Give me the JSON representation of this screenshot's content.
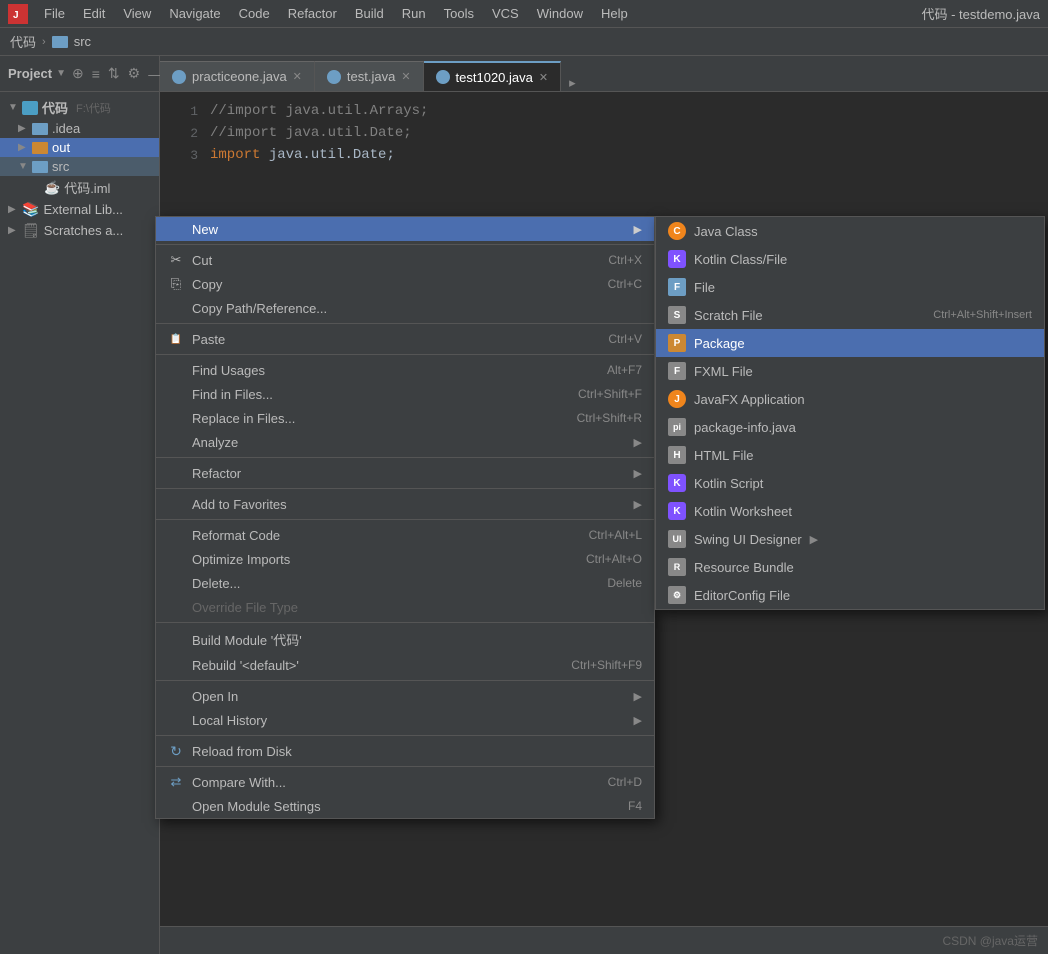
{
  "menubar": {
    "items": [
      "File",
      "Edit",
      "View",
      "Navigate",
      "Code",
      "Refactor",
      "Build",
      "Run",
      "Tools",
      "VCS",
      "Window",
      "Help"
    ],
    "title": "代码 - testdemo.java"
  },
  "breadcrumb": {
    "items": [
      "代码",
      "src"
    ]
  },
  "sidebar": {
    "title": "Project",
    "tree": [
      {
        "label": "代码",
        "sub": "F:\\代码",
        "type": "root",
        "indent": 0,
        "expanded": true
      },
      {
        "label": ".idea",
        "type": "folder",
        "indent": 1
      },
      {
        "label": "out",
        "type": "folder-orange",
        "indent": 1,
        "selected": true
      },
      {
        "label": "src",
        "type": "folder",
        "indent": 1,
        "highlighted": true
      },
      {
        "label": "代码.iml",
        "type": "file",
        "indent": 2
      },
      {
        "label": "External Lib...",
        "type": "lib",
        "indent": 0
      },
      {
        "label": "Scratches a...",
        "type": "scratch",
        "indent": 0
      }
    ]
  },
  "tabs": [
    {
      "label": "practiceone.java",
      "active": false,
      "color": "blue"
    },
    {
      "label": "test.java",
      "active": false,
      "color": "blue"
    },
    {
      "label": "test1020.java",
      "active": true,
      "color": "blue"
    }
  ],
  "code": [
    {
      "line": 1,
      "text": "//import java.util.Arrays;",
      "type": "comment"
    },
    {
      "line": 2,
      "text": "//import java.util.Date;",
      "type": "comment"
    },
    {
      "line": 3,
      "text": "import java.util.Date;",
      "type": "code"
    }
  ],
  "context_menu": {
    "items": [
      {
        "label": "New",
        "hasArrow": true,
        "highlighted": true
      },
      {
        "separator": true
      },
      {
        "label": "Cut",
        "icon": "scissors",
        "shortcut": "Ctrl+X"
      },
      {
        "label": "Copy",
        "icon": "copy",
        "shortcut": "Ctrl+C"
      },
      {
        "label": "Copy Path/Reference...",
        "indent": true
      },
      {
        "separator": true
      },
      {
        "label": "Paste",
        "icon": "paste",
        "shortcut": "Ctrl+V"
      },
      {
        "separator": true
      },
      {
        "label": "Find Usages",
        "shortcut": "Alt+F7"
      },
      {
        "label": "Find in Files...",
        "shortcut": "Ctrl+Shift+F"
      },
      {
        "label": "Replace in Files...",
        "shortcut": "Ctrl+Shift+R"
      },
      {
        "label": "Analyze",
        "hasArrow": true
      },
      {
        "separator": true
      },
      {
        "label": "Refactor",
        "hasArrow": true
      },
      {
        "separator": true
      },
      {
        "label": "Add to Favorites",
        "hasArrow": true
      },
      {
        "separator": true
      },
      {
        "label": "Reformat Code",
        "shortcut": "Ctrl+Alt+L"
      },
      {
        "label": "Optimize Imports",
        "shortcut": "Ctrl+Alt+O"
      },
      {
        "label": "Delete...",
        "shortcut": "Delete"
      },
      {
        "label": "Override File Type",
        "disabled": true
      },
      {
        "separator": true
      },
      {
        "label": "Build Module '代码'",
        "indent": false
      },
      {
        "label": "Rebuild '<default>'",
        "shortcut": "Ctrl+Shift+F9"
      },
      {
        "separator": true
      },
      {
        "label": "Open In",
        "hasArrow": true
      },
      {
        "label": "Local History",
        "hasArrow": true
      },
      {
        "separator": true
      },
      {
        "label": "Reload from Disk",
        "icon": "reload"
      },
      {
        "separator": true
      },
      {
        "label": "Compare With...",
        "icon": "compare",
        "shortcut": "Ctrl+D"
      },
      {
        "label": "Open Module Settings",
        "shortcut": "F4"
      }
    ]
  },
  "submenu_new": {
    "items": [
      {
        "label": "Java Class",
        "icon": "java"
      },
      {
        "label": "Kotlin Class/File",
        "icon": "kotlin"
      },
      {
        "label": "File",
        "icon": "file"
      },
      {
        "label": "Scratch File",
        "icon": "scratch",
        "shortcut": "Ctrl+Alt+Shift+Insert"
      },
      {
        "label": "Package",
        "icon": "package",
        "highlighted": true
      },
      {
        "label": "FXML File",
        "icon": "fxml"
      },
      {
        "label": "JavaFX Application",
        "icon": "javafx"
      },
      {
        "label": "package-info.java",
        "icon": "pkginfo"
      },
      {
        "label": "HTML File",
        "icon": "html"
      },
      {
        "label": "Kotlin Script",
        "icon": "kscript"
      },
      {
        "label": "Kotlin Worksheet",
        "icon": "kworksheet"
      },
      {
        "label": "Swing UI Designer",
        "icon": "swing",
        "hasArrow": true
      },
      {
        "label": "Resource Bundle",
        "icon": "resource"
      },
      {
        "label": "EditorConfig File",
        "icon": "editor"
      }
    ]
  },
  "watermark": "CSDN @java运营"
}
